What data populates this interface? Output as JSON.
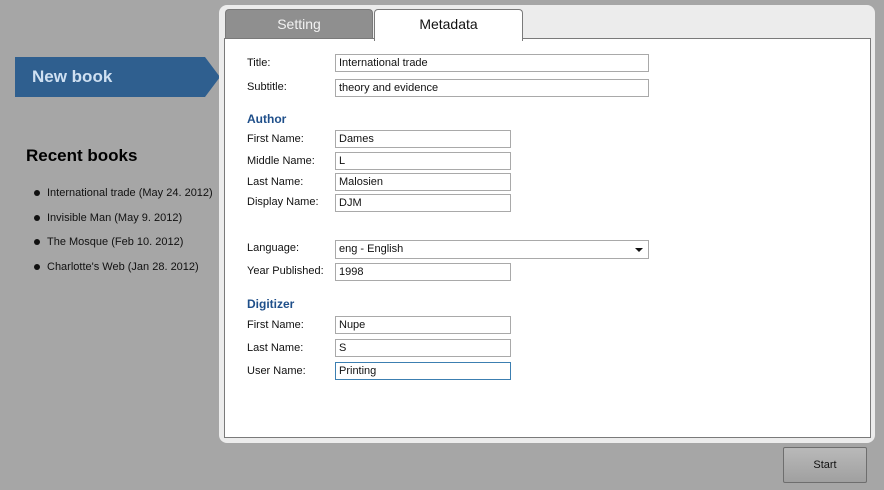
{
  "sidebar": {
    "new_book_label": "New book",
    "recent_title": "Recent books",
    "recent": [
      "International trade (May 24. 2012)",
      "Invisible Man (May 9. 2012)",
      "The Mosque (Feb 10. 2012)",
      "Charlotte's Web (Jan 28. 2012)"
    ]
  },
  "tabs": {
    "setting": "Setting",
    "metadata": "Metadata",
    "active": "Metadata"
  },
  "form": {
    "title_label": "Title:",
    "title_value": "International trade",
    "subtitle_label": "Subtitle:",
    "subtitle_value": "theory and evidence",
    "author_heading": "Author",
    "author_first_label": "First Name:",
    "author_first_value": "Dames",
    "author_middle_label": "Middle Name:",
    "author_middle_value": "L",
    "author_last_label": "Last Name:",
    "author_last_value": "Malosien",
    "author_display_label": "Display Name:",
    "author_display_value": "DJM",
    "language_label": "Language:",
    "language_value": "eng - English",
    "year_label": "Year Published:",
    "year_value": "1998",
    "digitizer_heading": "Digitizer",
    "dig_first_label": "First Name:",
    "dig_first_value": "Nupe",
    "dig_last_label": "Last Name:",
    "dig_last_value": "S",
    "dig_user_label": "User Name:",
    "dig_user_value": "Printing"
  },
  "footer": {
    "start_label": "Start"
  },
  "colors": {
    "background": "#a6a6a6",
    "new_book_button": "#2f5f8f",
    "section_heading": "#1f4f8a",
    "focus_border": "#3c7fb1"
  },
  "icons": {
    "language_dropdown": "chevron-down-icon",
    "recent_bullet": "bullet-icon"
  }
}
